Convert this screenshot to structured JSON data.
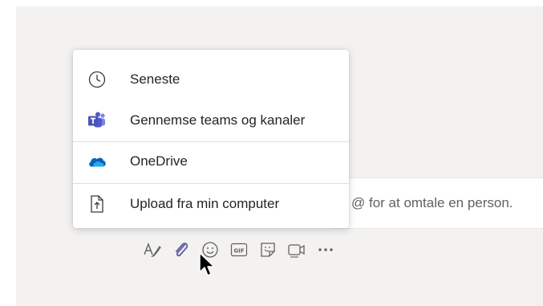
{
  "attach_menu": {
    "items": [
      {
        "label": "Seneste",
        "icon": "clock-icon"
      },
      {
        "label": "Gennemse teams og kanaler",
        "icon": "teams-icon"
      },
      {
        "label": "OneDrive",
        "icon": "onedrive-cloud-icon"
      },
      {
        "label": "Upload fra min computer",
        "icon": "upload-file-icon"
      }
    ]
  },
  "compose": {
    "placeholder_visible": "@ for at omtale en person."
  },
  "toolbar": {
    "buttons": [
      "format-icon",
      "attach-icon",
      "emoji-icon",
      "gif-icon",
      "sticker-icon",
      "meet-now-icon",
      "more-options-icon"
    ],
    "gif_text": "GIF"
  },
  "colors": {
    "accent": "#6264a7",
    "onedrive": "#0364b8",
    "icon_gray": "#616161",
    "background": "#f3f2f1"
  }
}
